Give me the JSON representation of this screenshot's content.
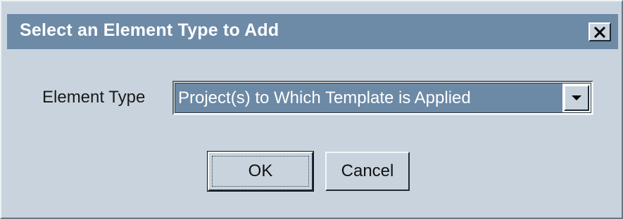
{
  "dialog": {
    "title": "Select an Element Type to Add",
    "close_label": "X",
    "element_type": {
      "label": "Element Type",
      "selected_value": "Project(s) to Which Template is Applied"
    },
    "buttons": {
      "ok_label": "OK",
      "cancel_label": "Cancel"
    }
  },
  "icons": {
    "close": "close-icon",
    "dropdown": "chevron-down-icon"
  },
  "colors": {
    "titlebar": "#6d8aa7",
    "dialog_bg": "#c8d3dd",
    "selection_bg": "#6c8aa6",
    "title_text": "#ffffff"
  }
}
